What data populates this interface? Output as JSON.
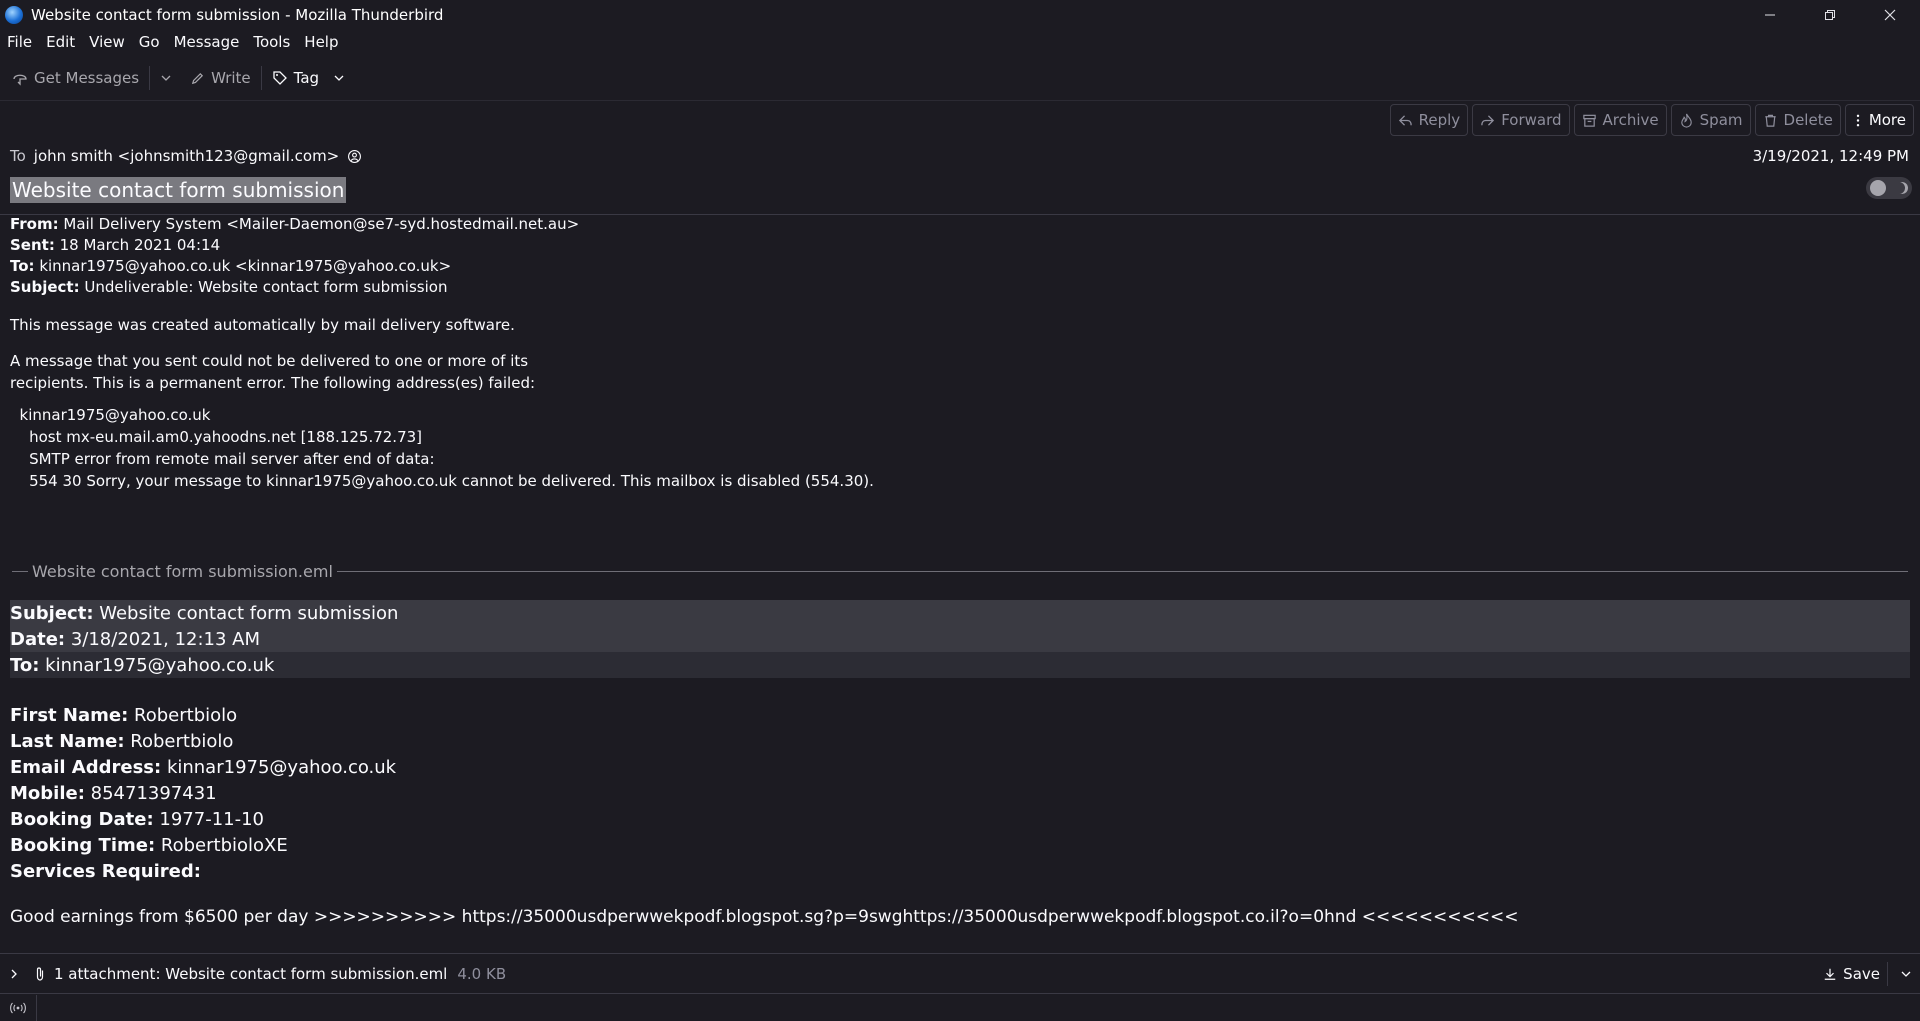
{
  "window": {
    "title": "Website contact form submission - Mozilla Thunderbird"
  },
  "menu": [
    "File",
    "Edit",
    "View",
    "Go",
    "Message",
    "Tools",
    "Help"
  ],
  "toolbar": {
    "get_messages": "Get Messages",
    "write": "Write",
    "tag": "Tag"
  },
  "header": {
    "actions": [
      "Reply",
      "Forward",
      "Archive",
      "Spam",
      "Delete",
      "More"
    ],
    "to_label": "To",
    "to_value": "john smith <johnsmith123@gmail.com>",
    "date": "3/19/2021, 12:49 PM",
    "subject": "Website contact form submission"
  },
  "bounce": {
    "from_label": "From:",
    "from_value": " Mail Delivery System <Mailer-Daemon@se7-syd.hostedmail.net.au>",
    "sent_label": "Sent:",
    "sent_value": " 18 March 2021 04:14",
    "to_label": "To:",
    "to_value": " kinnar1975@yahoo.co.uk <kinnar1975@yahoo.co.uk>",
    "subject_label": "Subject:",
    "subject_value": " Undeliverable: Website contact form submission",
    "line1": "This message was created automatically by mail delivery software.",
    "line2": "A message that you sent could not be delivered to one or more of its",
    "line3": "recipients. This is a permanent error. The following address(es) failed:",
    "line4": "  kinnar1975@yahoo.co.uk",
    "line5": "    host mx-eu.mail.am0.yahoodns.net [188.125.72.73]",
    "line6": "    SMTP error from remote mail server after end of data:",
    "line7": "    554 30 Sorry, your message to kinnar1975@yahoo.co.uk cannot be delivered. This mailbox is disabled (554.30)."
  },
  "attachment_divider": "Website contact form submission.eml",
  "forwarded": {
    "subject_label": "Subject:",
    "subject_value": " Website contact form submission",
    "date_label": "Date:",
    "date_value": " 3/18/2021, 12:13 AM",
    "to_label": "To:",
    "to_value": " kinnar1975@yahoo.co.uk",
    "fields": [
      {
        "label": "First Name:",
        "value": " Robertbiolo"
      },
      {
        "label": "Last Name:",
        "value": " Robertbiolo"
      },
      {
        "label": "Email Address:",
        "value": " kinnar1975@yahoo.co.uk"
      },
      {
        "label": "Mobile:",
        "value": " 85471397431"
      },
      {
        "label": "Booking Date:",
        "value": " 1977-11-10"
      },
      {
        "label": "Booking Time:",
        "value": " RobertbioloXE"
      },
      {
        "label": "Services Required:",
        "value": ""
      }
    ],
    "spam_line": "Good earnings from $6500 per day >>>>>>>>>> https://35000usdperwwekpodf.blogspot.sg?p=9swghttps://35000usdperwwekpodf.blogspot.co.il?o=0hnd <<<<<<<<<<<"
  },
  "attachment_bar": {
    "count": "1 attachment: Website contact form submission.eml",
    "size": "4.0 KB",
    "save": "Save"
  }
}
